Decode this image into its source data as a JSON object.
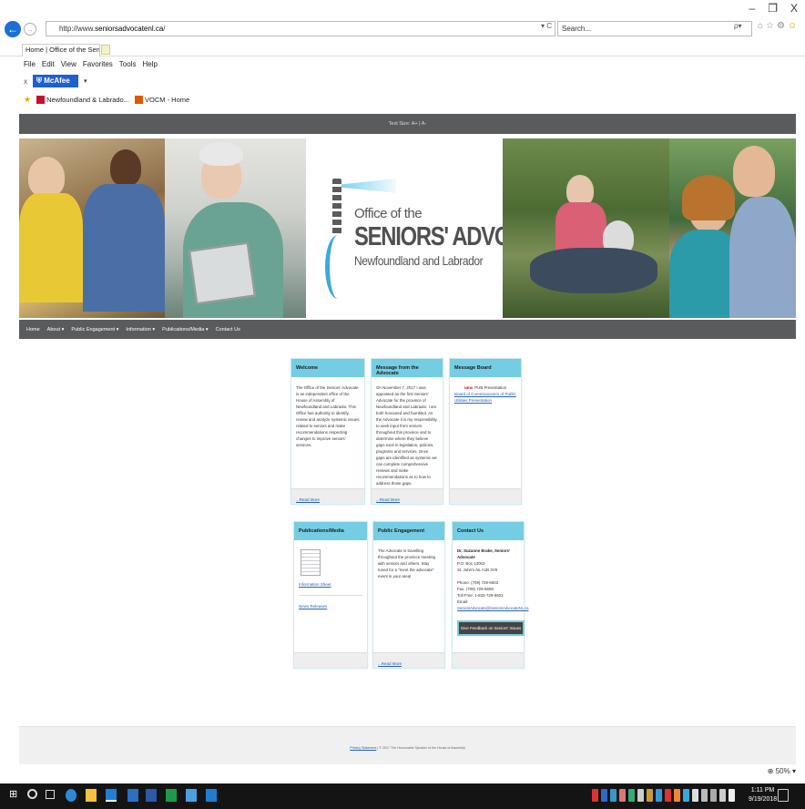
{
  "window": {
    "minimize": "–",
    "restore": "❐",
    "close": "X"
  },
  "browser": {
    "address_prefix": "http://www.",
    "address_domain": "seniorsadvocatenl.ca",
    "address_suffix": "/",
    "address_controls": "▾ C",
    "search_placeholder": "Search...",
    "search_controls": "ρ▾",
    "tab_title": "Home | Office of the Senior... ×",
    "menu": [
      "File",
      "Edit",
      "View",
      "Favorites",
      "Tools",
      "Help"
    ],
    "mcafee_close": "x",
    "mcafee_label": "McAfee",
    "mcafee_dropdown": "▾",
    "favorites": [
      "Newfoundland & Labrado...",
      "VOCM - Home"
    ],
    "zoom": "50%"
  },
  "site": {
    "text_size": "Text Size: A+ | A-",
    "logo": {
      "line1": "Office of the",
      "line2": "SENIORS' ADVOCATE",
      "line3": "Newfoundland and Labrador"
    },
    "nav": [
      "Home",
      "About",
      "Public Engagement",
      "Information",
      "Publications/Media",
      "Contact Us"
    ],
    "cards": {
      "welcome": {
        "title": "Welcome",
        "body": "The Office of the Seniors' Advocate is an independent office of the House of Assembly of Newfoundland and Labrador. This Office has authority to identify, review and analyze systemic issues related to seniors and make recommendations respecting changes to improve seniors' services.",
        "link": "...Read More"
      },
      "message": {
        "title": "Message from the Advocate",
        "body": "On November 7, 2017 I was appointed as the first Seniors' Advocate for the province of Newfoundland and Labrador. I am both honoured and humbled. As the Advocate it is my responsibility to seek input from seniors throughout this province and to determine where they believe gaps exist in legislation, policies, programs and services. Once gaps are identified as systemic we can complete comprehensive reviews and make recommendations as to how to address those gaps.",
        "link": "...Read More"
      },
      "board": {
        "title": "Message Board",
        "new_badge": "NEW",
        "item": "PUB Presentation",
        "link": "Board of Commissioners of Public Utilities Presentation"
      },
      "publications": {
        "title": "Publications/Media",
        "link1": "Information Sheet",
        "link2": "News Releases"
      },
      "engagement": {
        "title": "Public Engagement",
        "body": "The Advocate is travelling throughout the province meeting with seniors and others. Stay tuned for a \"meet the advocate\" event in your area!",
        "link": "...Read More"
      },
      "contact": {
        "title": "Contact Us",
        "name": "Dr. Suzanne Brake, Seniors' Advocate",
        "address1": "P.O. Box 13003",
        "address2": "St. John's NL  A1B 3V8",
        "phone": "Phone: (709) 729-6603",
        "fax": "Fax: (709) 729-6608",
        "tollfree": "Toll Free: 1-833-729-6603",
        "email_label": "Email: ",
        "email": "SeniorsAdvocate@SeniorsAdvocateNL.ca",
        "button": "Give Feedback on Seniors' Issues"
      }
    },
    "footer": {
      "privacy": "Privacy Statement",
      "copyright": " | © 2017 The Honourable Speaker of the House of Assembly"
    }
  },
  "taskbar": {
    "time": "1:11 PM",
    "date": "9/19/2018"
  }
}
